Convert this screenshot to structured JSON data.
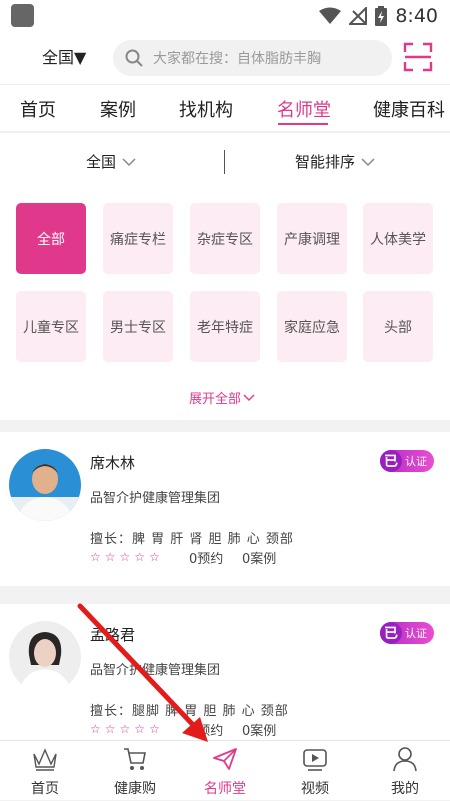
{
  "status": {
    "time": "8:40"
  },
  "header": {
    "region": "全国▼",
    "search_placeholder": "大家都在搜：自体脂肪丰胸"
  },
  "tabs": [
    {
      "label": "首页"
    },
    {
      "label": "案例"
    },
    {
      "label": "找机构"
    },
    {
      "label": "名师堂",
      "active": true
    },
    {
      "label": "健康百科"
    }
  ],
  "filters": {
    "region": "全国",
    "sort": "智能排序"
  },
  "categories": [
    {
      "label": "全部",
      "active": true
    },
    {
      "label": "痛症专栏"
    },
    {
      "label": "杂症专区"
    },
    {
      "label": "产康调理"
    },
    {
      "label": "人体美学"
    },
    {
      "label": "儿童专区"
    },
    {
      "label": "男士专区"
    },
    {
      "label": "老年特症"
    },
    {
      "label": "家庭应急"
    },
    {
      "label": "头部"
    }
  ],
  "expand_label": "展开全部",
  "doctors": [
    {
      "name": "席木林",
      "org": "品智介护健康管理集团",
      "skills": "擅长：脾 胃 肝 肾 胆 肺 心 颈部",
      "appointments": "0预约",
      "cases": "0案例",
      "badge_mark": "已",
      "badge_text": "认证"
    },
    {
      "name": "孟路君",
      "org": "品智介护健康管理集团",
      "skills": "擅长：腿脚 脾 胃 胆 肺 心 颈部",
      "appointments": "0预约",
      "cases": "0案例",
      "badge_mark": "已",
      "badge_text": "认证"
    }
  ],
  "bottom_nav": [
    {
      "label": "首页",
      "icon": "crown-icon"
    },
    {
      "label": "健康购",
      "icon": "cart-icon"
    },
    {
      "label": "名师堂",
      "icon": "paper-plane-icon",
      "active": true
    },
    {
      "label": "视频",
      "icon": "video-icon"
    },
    {
      "label": "我的",
      "icon": "user-icon"
    }
  ],
  "colors": {
    "accent": "#e0398c",
    "category_bg": "#fdecf3",
    "annotation_arrow": "#e31b1b"
  }
}
